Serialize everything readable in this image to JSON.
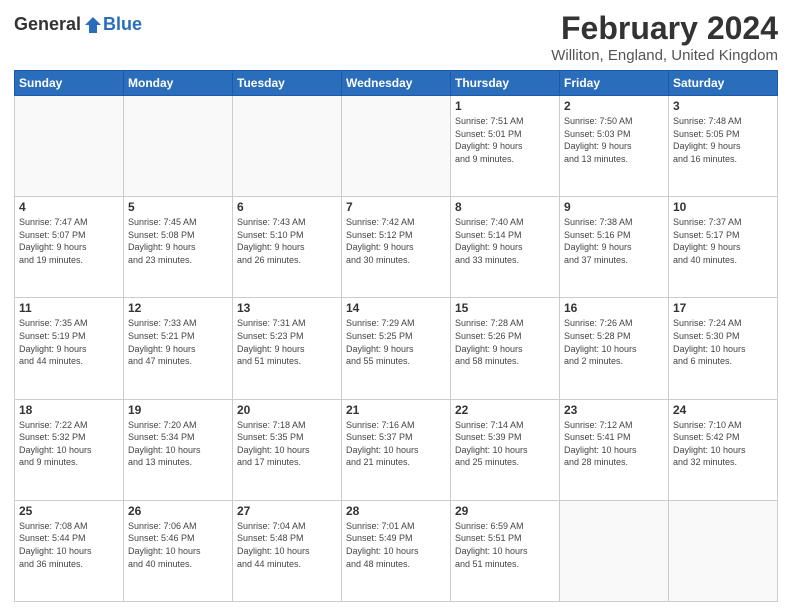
{
  "header": {
    "logo_general": "General",
    "logo_blue": "Blue",
    "title": "February 2024",
    "subtitle": "Williton, England, United Kingdom"
  },
  "weekdays": [
    "Sunday",
    "Monday",
    "Tuesday",
    "Wednesday",
    "Thursday",
    "Friday",
    "Saturday"
  ],
  "weeks": [
    [
      {
        "day": "",
        "info": ""
      },
      {
        "day": "",
        "info": ""
      },
      {
        "day": "",
        "info": ""
      },
      {
        "day": "",
        "info": ""
      },
      {
        "day": "1",
        "info": "Sunrise: 7:51 AM\nSunset: 5:01 PM\nDaylight: 9 hours\nand 9 minutes."
      },
      {
        "day": "2",
        "info": "Sunrise: 7:50 AM\nSunset: 5:03 PM\nDaylight: 9 hours\nand 13 minutes."
      },
      {
        "day": "3",
        "info": "Sunrise: 7:48 AM\nSunset: 5:05 PM\nDaylight: 9 hours\nand 16 minutes."
      }
    ],
    [
      {
        "day": "4",
        "info": "Sunrise: 7:47 AM\nSunset: 5:07 PM\nDaylight: 9 hours\nand 19 minutes."
      },
      {
        "day": "5",
        "info": "Sunrise: 7:45 AM\nSunset: 5:08 PM\nDaylight: 9 hours\nand 23 minutes."
      },
      {
        "day": "6",
        "info": "Sunrise: 7:43 AM\nSunset: 5:10 PM\nDaylight: 9 hours\nand 26 minutes."
      },
      {
        "day": "7",
        "info": "Sunrise: 7:42 AM\nSunset: 5:12 PM\nDaylight: 9 hours\nand 30 minutes."
      },
      {
        "day": "8",
        "info": "Sunrise: 7:40 AM\nSunset: 5:14 PM\nDaylight: 9 hours\nand 33 minutes."
      },
      {
        "day": "9",
        "info": "Sunrise: 7:38 AM\nSunset: 5:16 PM\nDaylight: 9 hours\nand 37 minutes."
      },
      {
        "day": "10",
        "info": "Sunrise: 7:37 AM\nSunset: 5:17 PM\nDaylight: 9 hours\nand 40 minutes."
      }
    ],
    [
      {
        "day": "11",
        "info": "Sunrise: 7:35 AM\nSunset: 5:19 PM\nDaylight: 9 hours\nand 44 minutes."
      },
      {
        "day": "12",
        "info": "Sunrise: 7:33 AM\nSunset: 5:21 PM\nDaylight: 9 hours\nand 47 minutes."
      },
      {
        "day": "13",
        "info": "Sunrise: 7:31 AM\nSunset: 5:23 PM\nDaylight: 9 hours\nand 51 minutes."
      },
      {
        "day": "14",
        "info": "Sunrise: 7:29 AM\nSunset: 5:25 PM\nDaylight: 9 hours\nand 55 minutes."
      },
      {
        "day": "15",
        "info": "Sunrise: 7:28 AM\nSunset: 5:26 PM\nDaylight: 9 hours\nand 58 minutes."
      },
      {
        "day": "16",
        "info": "Sunrise: 7:26 AM\nSunset: 5:28 PM\nDaylight: 10 hours\nand 2 minutes."
      },
      {
        "day": "17",
        "info": "Sunrise: 7:24 AM\nSunset: 5:30 PM\nDaylight: 10 hours\nand 6 minutes."
      }
    ],
    [
      {
        "day": "18",
        "info": "Sunrise: 7:22 AM\nSunset: 5:32 PM\nDaylight: 10 hours\nand 9 minutes."
      },
      {
        "day": "19",
        "info": "Sunrise: 7:20 AM\nSunset: 5:34 PM\nDaylight: 10 hours\nand 13 minutes."
      },
      {
        "day": "20",
        "info": "Sunrise: 7:18 AM\nSunset: 5:35 PM\nDaylight: 10 hours\nand 17 minutes."
      },
      {
        "day": "21",
        "info": "Sunrise: 7:16 AM\nSunset: 5:37 PM\nDaylight: 10 hours\nand 21 minutes."
      },
      {
        "day": "22",
        "info": "Sunrise: 7:14 AM\nSunset: 5:39 PM\nDaylight: 10 hours\nand 25 minutes."
      },
      {
        "day": "23",
        "info": "Sunrise: 7:12 AM\nSunset: 5:41 PM\nDaylight: 10 hours\nand 28 minutes."
      },
      {
        "day": "24",
        "info": "Sunrise: 7:10 AM\nSunset: 5:42 PM\nDaylight: 10 hours\nand 32 minutes."
      }
    ],
    [
      {
        "day": "25",
        "info": "Sunrise: 7:08 AM\nSunset: 5:44 PM\nDaylight: 10 hours\nand 36 minutes."
      },
      {
        "day": "26",
        "info": "Sunrise: 7:06 AM\nSunset: 5:46 PM\nDaylight: 10 hours\nand 40 minutes."
      },
      {
        "day": "27",
        "info": "Sunrise: 7:04 AM\nSunset: 5:48 PM\nDaylight: 10 hours\nand 44 minutes."
      },
      {
        "day": "28",
        "info": "Sunrise: 7:01 AM\nSunset: 5:49 PM\nDaylight: 10 hours\nand 48 minutes."
      },
      {
        "day": "29",
        "info": "Sunrise: 6:59 AM\nSunset: 5:51 PM\nDaylight: 10 hours\nand 51 minutes."
      },
      {
        "day": "",
        "info": ""
      },
      {
        "day": "",
        "info": ""
      }
    ]
  ]
}
